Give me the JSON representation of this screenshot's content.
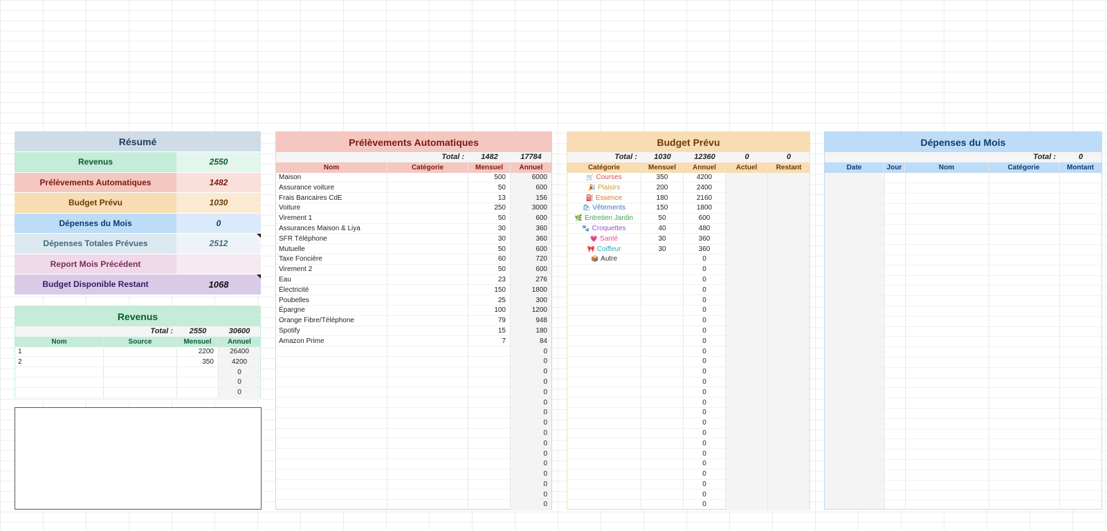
{
  "colors": {
    "resume_title_bg": "#cfdce8",
    "resume_title_fg": "#1f3b5c",
    "revenus_bg": "#c5ecd9",
    "revenus_fg": "#0b5a33",
    "prelev_bg": "#f4c7c0",
    "prelev_fg": "#7a1a10",
    "budget_bg": "#f8dcb4",
    "budget_fg": "#6b3c05",
    "depenses_bg": "#bcdcf7",
    "depenses_fg": "#123a6b",
    "totales_bg": "#dde9f0",
    "totales_fg": "#3c6a80",
    "report_bg": "#f0d9e8",
    "report_fg": "#7a2d5a",
    "dispo_bg": "#d9cbe6",
    "dispo_fg": "#3b1a66"
  },
  "resume": {
    "title": "Résumé",
    "rows": [
      {
        "label": "Revenus",
        "value": "2550"
      },
      {
        "label": "Prélèvements Automatiques",
        "value": "1482"
      },
      {
        "label": "Budget Prévu",
        "value": "1030"
      },
      {
        "label": "Dépenses du Mois",
        "value": "0"
      },
      {
        "label": "Dépenses Totales Prévues",
        "value": "2512"
      },
      {
        "label": "Report Mois Précédent",
        "value": ""
      },
      {
        "label": "Budget Disponible Restant",
        "value": "1068"
      }
    ]
  },
  "revenus": {
    "title": "Revenus",
    "total_label": "Total :",
    "total_monthly": "2550",
    "total_annual": "30600",
    "headers": [
      "Nom",
      "Source",
      "Mensuel",
      "Annuel"
    ],
    "rows": [
      [
        "1",
        "",
        "2200",
        "26400"
      ],
      [
        "2",
        "",
        "350",
        "4200"
      ],
      [
        "",
        "",
        "",
        "0"
      ],
      [
        "",
        "",
        "",
        "0"
      ],
      [
        "",
        "",
        "",
        "0"
      ]
    ]
  },
  "prelevements": {
    "title": "Prélèvements Automatiques",
    "total_label": "Total :",
    "total_monthly": "1482",
    "total_annual": "17784",
    "headers": [
      "Nom",
      "Catégorie",
      "Mensuel",
      "Annuel"
    ],
    "rows": [
      [
        "Maison",
        "",
        "500",
        "6000"
      ],
      [
        "Assurance voiture",
        "",
        "50",
        "600"
      ],
      [
        "Frais Bancaires CdE",
        "",
        "13",
        "156"
      ],
      [
        "Voiture",
        "",
        "250",
        "3000"
      ],
      [
        "Virement 1",
        "",
        "50",
        "600"
      ],
      [
        "Assurances Maison & Liya",
        "",
        "30",
        "360"
      ],
      [
        "SFR Téléphone",
        "",
        "30",
        "360"
      ],
      [
        "Mutuelle",
        "",
        "50",
        "600"
      ],
      [
        "Taxe Foncière",
        "",
        "60",
        "720"
      ],
      [
        "Virement 2",
        "",
        "50",
        "600"
      ],
      [
        "Eau",
        "",
        "23",
        "276"
      ],
      [
        "Électricité",
        "",
        "150",
        "1800"
      ],
      [
        "Poubelles",
        "",
        "25",
        "300"
      ],
      [
        "Épargne",
        "",
        "100",
        "1200"
      ],
      [
        "Orange Fibre/Téléphone",
        "",
        "79",
        "948"
      ],
      [
        "Spotify",
        "",
        "15",
        "180"
      ],
      [
        "Amazon Prime",
        "",
        "7",
        "84"
      ],
      [
        "",
        "",
        "",
        "0"
      ],
      [
        "",
        "",
        "",
        "0"
      ],
      [
        "",
        "",
        "",
        "0"
      ],
      [
        "",
        "",
        "",
        "0"
      ],
      [
        "",
        "",
        "",
        "0"
      ],
      [
        "",
        "",
        "",
        "0"
      ],
      [
        "",
        "",
        "",
        "0"
      ],
      [
        "",
        "",
        "",
        "0"
      ],
      [
        "",
        "",
        "",
        "0"
      ],
      [
        "",
        "",
        "",
        "0"
      ],
      [
        "",
        "",
        "",
        "0"
      ],
      [
        "",
        "",
        "",
        "0"
      ],
      [
        "",
        "",
        "",
        "0"
      ],
      [
        "",
        "",
        "",
        "0"
      ],
      [
        "",
        "",
        "",
        "0"
      ],
      [
        "",
        "",
        "",
        "0"
      ]
    ]
  },
  "budget": {
    "title": "Budget Prévu",
    "total_label": "Total :",
    "total_monthly": "1030",
    "total_annual": "12360",
    "total_actual": "0",
    "total_remaining": "0",
    "headers": [
      "Catégorie",
      "Mensuel",
      "Annuel",
      "Actuel",
      "Restant"
    ],
    "rows": [
      {
        "emoji": "🛒",
        "name": "Courses",
        "color": "#d94c4c",
        "monthly": "350",
        "annual": "4200"
      },
      {
        "emoji": "🎉",
        "name": "Plaisirs",
        "color": "#c9a227",
        "monthly": "200",
        "annual": "2400"
      },
      {
        "emoji": "⛽",
        "name": "Essence",
        "color": "#e0742c",
        "monthly": "180",
        "annual": "2160"
      },
      {
        "emoji": "🛍",
        "name": "Vêtements",
        "color": "#3a78c9",
        "monthly": "150",
        "annual": "1800"
      },
      {
        "emoji": "🌿",
        "name": "Entretien Jardin",
        "color": "#3fa34d",
        "monthly": "50",
        "annual": "600"
      },
      {
        "emoji": "🐾",
        "name": "Croquettes",
        "color": "#9b4fd1",
        "monthly": "40",
        "annual": "480"
      },
      {
        "emoji": "💗",
        "name": "Santé",
        "color": "#e0508a",
        "monthly": "30",
        "annual": "360"
      },
      {
        "emoji": "🎀",
        "name": "Coiffeur",
        "color": "#2aa9b8",
        "monthly": "30",
        "annual": "360"
      },
      {
        "emoji": "📦",
        "name": "Autre",
        "color": "#333333",
        "monthly": "",
        "annual": "0"
      },
      {
        "emoji": "",
        "name": "",
        "color": "#333333",
        "monthly": "",
        "annual": "0"
      },
      {
        "emoji": "",
        "name": "",
        "color": "#333333",
        "monthly": "",
        "annual": "0"
      },
      {
        "emoji": "",
        "name": "",
        "color": "#333333",
        "monthly": "",
        "annual": "0"
      },
      {
        "emoji": "",
        "name": "",
        "color": "#333333",
        "monthly": "",
        "annual": "0"
      },
      {
        "emoji": "",
        "name": "",
        "color": "#333333",
        "monthly": "",
        "annual": "0"
      },
      {
        "emoji": "",
        "name": "",
        "color": "#333333",
        "monthly": "",
        "annual": "0"
      },
      {
        "emoji": "",
        "name": "",
        "color": "#333333",
        "monthly": "",
        "annual": "0"
      },
      {
        "emoji": "",
        "name": "",
        "color": "#333333",
        "monthly": "",
        "annual": "0"
      },
      {
        "emoji": "",
        "name": "",
        "color": "#333333",
        "monthly": "",
        "annual": "0"
      },
      {
        "emoji": "",
        "name": "",
        "color": "#333333",
        "monthly": "",
        "annual": "0"
      },
      {
        "emoji": "",
        "name": "",
        "color": "#333333",
        "monthly": "",
        "annual": "0"
      },
      {
        "emoji": "",
        "name": "",
        "color": "#333333",
        "monthly": "",
        "annual": "0"
      },
      {
        "emoji": "",
        "name": "",
        "color": "#333333",
        "monthly": "",
        "annual": "0"
      },
      {
        "emoji": "",
        "name": "",
        "color": "#333333",
        "monthly": "",
        "annual": "0"
      },
      {
        "emoji": "",
        "name": "",
        "color": "#333333",
        "monthly": "",
        "annual": "0"
      },
      {
        "emoji": "",
        "name": "",
        "color": "#333333",
        "monthly": "",
        "annual": "0"
      },
      {
        "emoji": "",
        "name": "",
        "color": "#333333",
        "monthly": "",
        "annual": "0"
      },
      {
        "emoji": "",
        "name": "",
        "color": "#333333",
        "monthly": "",
        "annual": "0"
      },
      {
        "emoji": "",
        "name": "",
        "color": "#333333",
        "monthly": "",
        "annual": "0"
      },
      {
        "emoji": "",
        "name": "",
        "color": "#333333",
        "monthly": "",
        "annual": "0"
      },
      {
        "emoji": "",
        "name": "",
        "color": "#333333",
        "monthly": "",
        "annual": "0"
      },
      {
        "emoji": "",
        "name": "",
        "color": "#333333",
        "monthly": "",
        "annual": "0"
      },
      {
        "emoji": "",
        "name": "",
        "color": "#333333",
        "monthly": "",
        "annual": "0"
      },
      {
        "emoji": "",
        "name": "",
        "color": "#333333",
        "monthly": "",
        "annual": "0"
      }
    ]
  },
  "depenses": {
    "title": "Dépenses du Mois",
    "total_label": "Total :",
    "total_value": "0",
    "headers": [
      "Date",
      "Jour",
      "Nom",
      "Catégorie",
      "Montant"
    ]
  }
}
